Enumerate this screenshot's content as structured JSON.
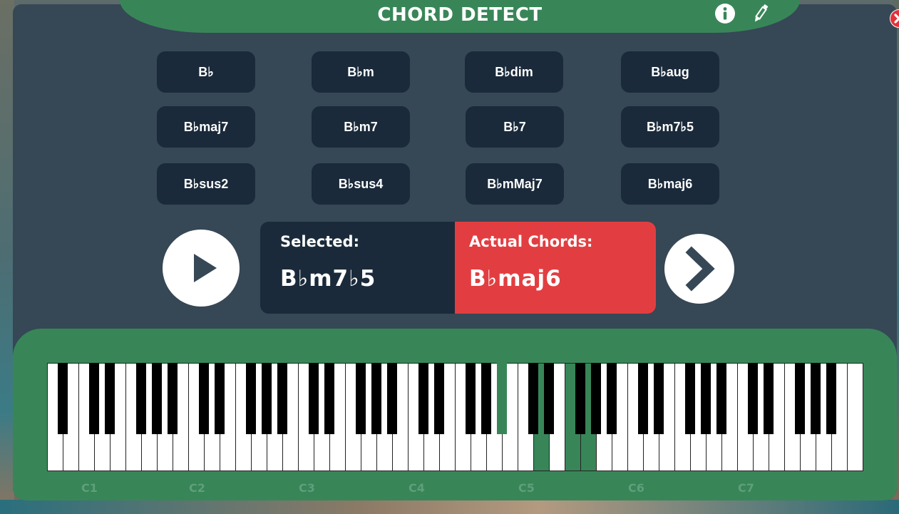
{
  "header": {
    "title": "CHORD DETECT"
  },
  "icons": {
    "info": "info-icon",
    "edit": "pencil-icon",
    "close": "close-icon",
    "play": "play-icon",
    "next": "chevron-right-icon"
  },
  "colors": {
    "header_green": "#388658",
    "panel_dark": "#1a2a3a",
    "app_bg": "#364756",
    "actual_red": "#e23e41",
    "close_red": "#e3323a"
  },
  "chord_buttons": [
    "B♭",
    "B♭m",
    "B♭dim",
    "B♭aug",
    "B♭maj7",
    "B♭m7",
    "B♭7",
    "B♭m7♭5",
    "B♭sus2",
    "B♭sus4",
    "B♭mMaj7",
    "B♭maj6"
  ],
  "result": {
    "selected_label": "Selected:",
    "selected_value": "B♭m7♭5",
    "actual_label": "Actual Chords:",
    "actual_value": "B♭maj6"
  },
  "keyboard": {
    "octave_labels": [
      "C1",
      "C2",
      "C3",
      "C4",
      "C5",
      "C6",
      "C7"
    ],
    "white_key_count": 52,
    "black_key_count": 36,
    "highlighted_notes": [
      "B♭4",
      "D5",
      "F5",
      "G5"
    ]
  }
}
